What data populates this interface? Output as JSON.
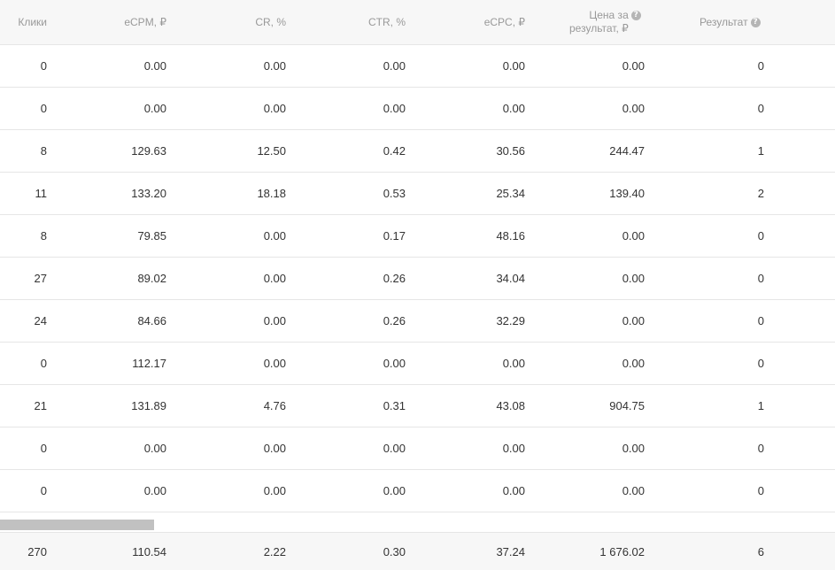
{
  "header": {
    "clicks": "Клики",
    "ecpm": "eCPM, ₽",
    "cr": "CR, %",
    "ctr": "CTR, %",
    "ecpc": "eCPC, ₽",
    "cost_line1": "Цена за",
    "cost_line2": "результат, ₽",
    "result": "Результат",
    "help_glyph": "?"
  },
  "rows": [
    {
      "clicks": "0",
      "ecpm": "0.00",
      "cr": "0.00",
      "ctr": "0.00",
      "ecpc": "0.00",
      "cost": "0.00",
      "result": "0"
    },
    {
      "clicks": "0",
      "ecpm": "0.00",
      "cr": "0.00",
      "ctr": "0.00",
      "ecpc": "0.00",
      "cost": "0.00",
      "result": "0"
    },
    {
      "clicks": "8",
      "ecpm": "129.63",
      "cr": "12.50",
      "ctr": "0.42",
      "ecpc": "30.56",
      "cost": "244.47",
      "result": "1"
    },
    {
      "clicks": "11",
      "ecpm": "133.20",
      "cr": "18.18",
      "ctr": "0.53",
      "ecpc": "25.34",
      "cost": "139.40",
      "result": "2"
    },
    {
      "clicks": "8",
      "ecpm": "79.85",
      "cr": "0.00",
      "ctr": "0.17",
      "ecpc": "48.16",
      "cost": "0.00",
      "result": "0"
    },
    {
      "clicks": "27",
      "ecpm": "89.02",
      "cr": "0.00",
      "ctr": "0.26",
      "ecpc": "34.04",
      "cost": "0.00",
      "result": "0"
    },
    {
      "clicks": "24",
      "ecpm": "84.66",
      "cr": "0.00",
      "ctr": "0.26",
      "ecpc": "32.29",
      "cost": "0.00",
      "result": "0"
    },
    {
      "clicks": "0",
      "ecpm": "112.17",
      "cr": "0.00",
      "ctr": "0.00",
      "ecpc": "0.00",
      "cost": "0.00",
      "result": "0"
    },
    {
      "clicks": "21",
      "ecpm": "131.89",
      "cr": "4.76",
      "ctr": "0.31",
      "ecpc": "43.08",
      "cost": "904.75",
      "result": "1"
    },
    {
      "clicks": "0",
      "ecpm": "0.00",
      "cr": "0.00",
      "ctr": "0.00",
      "ecpc": "0.00",
      "cost": "0.00",
      "result": "0"
    },
    {
      "clicks": "0",
      "ecpm": "0.00",
      "cr": "0.00",
      "ctr": "0.00",
      "ecpc": "0.00",
      "cost": "0.00",
      "result": "0"
    }
  ],
  "totals": {
    "clicks": "270",
    "ecpm": "110.54",
    "cr": "2.22",
    "ctr": "0.30",
    "ecpc": "37.24",
    "cost": "1 676.02",
    "result": "6"
  },
  "colors": {
    "header_bg": "#f7f7f7",
    "header_text": "#999999",
    "border": "#e6e6e6",
    "scroll_thumb": "#c1c1c1"
  }
}
